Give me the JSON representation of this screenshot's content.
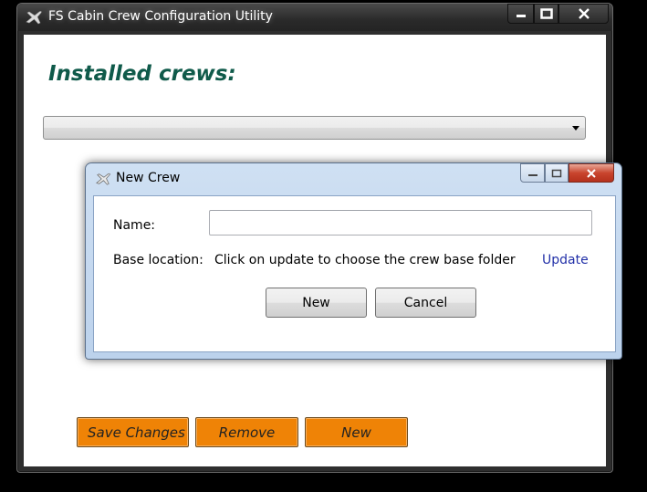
{
  "main_window": {
    "title": "FS Cabin Crew Configuration Utility",
    "heading": "Installed crews:",
    "crew_select_value": "",
    "buttons": {
      "save": "Save Changes",
      "remove": "Remove",
      "new": "New"
    },
    "button_color": "#ef8306",
    "heading_color": "#0f5a4a",
    "icons": {
      "app": "airplane-icon",
      "minimize": "minimize-icon",
      "maximize": "maximize-icon",
      "close": "close-icon",
      "dropdown": "chevron-down-icon"
    }
  },
  "dialog": {
    "title": "New Crew",
    "name_label": "Name:",
    "name_value": "",
    "base_location_label": "Base location:",
    "base_location_value": "Click on update to choose the crew base folder",
    "update_link": "Update",
    "new_button": "New",
    "cancel_button": "Cancel",
    "link_color": "#2230a8"
  }
}
